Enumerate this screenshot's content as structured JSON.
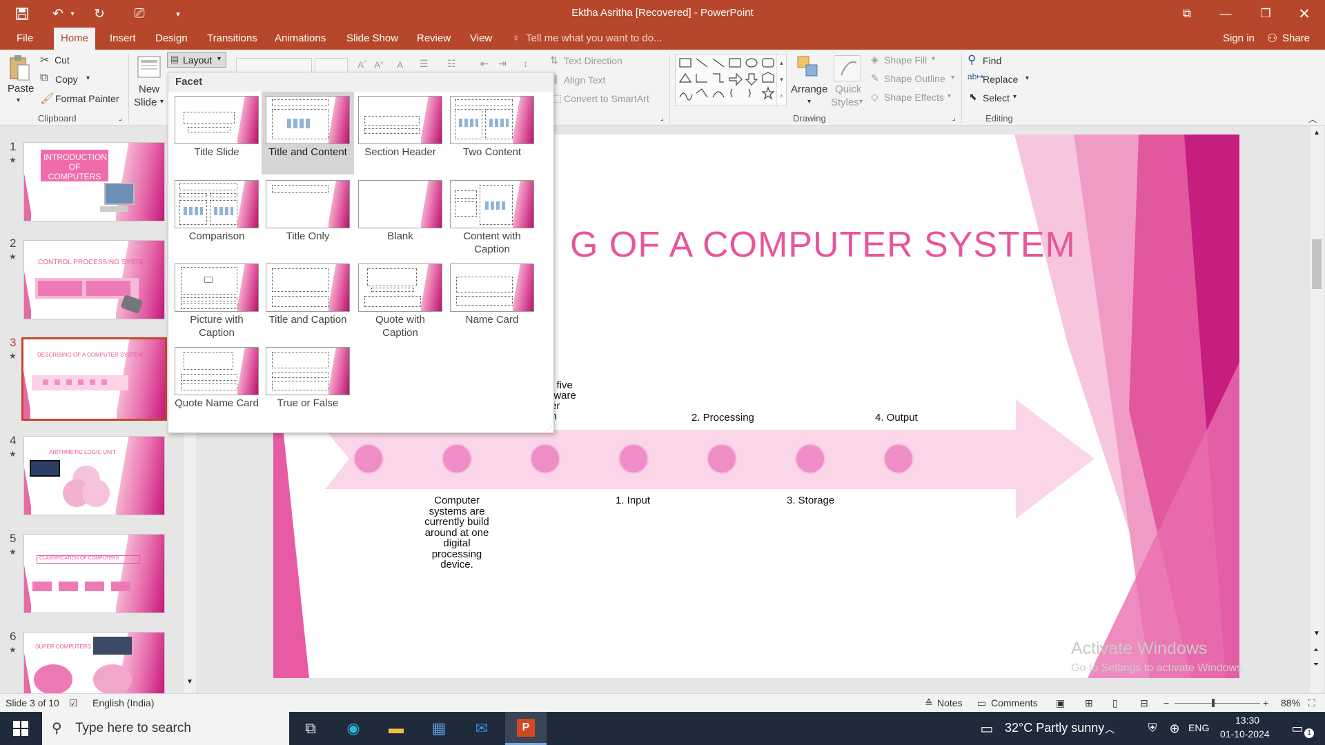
{
  "window": {
    "title": "Ektha Asritha [Recovered] - PowerPoint",
    "quick_access": [
      "save-icon",
      "undo-icon",
      "redo-icon",
      "present-icon",
      "customize-icon"
    ]
  },
  "menu": {
    "tabs": [
      "File",
      "Home",
      "Insert",
      "Design",
      "Transitions",
      "Animations",
      "Slide Show",
      "Review",
      "View"
    ],
    "active_tab": "Home",
    "tell_me": "Tell me what you want to do...",
    "sign_in": "Sign in",
    "share": "Share"
  },
  "ribbon": {
    "clipboard": {
      "paste": "Paste",
      "cut": "Cut",
      "copy": "Copy",
      "format_painter": "Format Painter",
      "group_label": "Clipboard"
    },
    "slides": {
      "new_slide": "New",
      "new_slide_2": "Slide",
      "layout": "Layout"
    },
    "paragraph": {
      "text_direction": "Text Direction",
      "align_text": "Align Text",
      "convert_smartart": "Convert to SmartArt"
    },
    "drawing": {
      "arrange": "Arrange",
      "quick_styles": "Quick",
      "quick_styles_2": "Styles",
      "shape_fill": "Shape Fill",
      "shape_outline": "Shape Outline",
      "shape_effects": "Shape Effects",
      "group_label": "Drawing"
    },
    "editing": {
      "find": "Find",
      "replace": "Replace",
      "select": "Select",
      "group_label": "Editing"
    }
  },
  "layout_menu": {
    "header": "Facet",
    "items": [
      {
        "name": "Title Slide"
      },
      {
        "name": "Title and Content"
      },
      {
        "name": "Section Header"
      },
      {
        "name": "Two Content"
      },
      {
        "name": "Comparison"
      },
      {
        "name": "Title Only"
      },
      {
        "name": "Blank"
      },
      {
        "name": "Content with Caption"
      },
      {
        "name": "Picture with Caption"
      },
      {
        "name": "Title and Caption"
      },
      {
        "name": "Quote with Caption"
      },
      {
        "name": "Name Card"
      },
      {
        "name": "Quote Name Card"
      },
      {
        "name": "True or False"
      }
    ],
    "selected": "Title and Content"
  },
  "thumbnails": [
    {
      "num": "1",
      "title": "INTRODUCTION OF COMPUTERS"
    },
    {
      "num": "2",
      "title": "CONTROL PROCESSING SYSTE"
    },
    {
      "num": "3",
      "title": "DESCRIBING OF A COMPUTER SYSTEM"
    },
    {
      "num": "4",
      "title": "ARITHMETIC LOGIC UNIT"
    },
    {
      "num": "5",
      "title": "CLASSIFICATION OF COMPUTERS"
    },
    {
      "num": "6",
      "title": "SUPER COMPUTERS"
    }
  ],
  "slide": {
    "title": "G OF A COMPUTER SYSTEM",
    "intro_fragment": [
      "e five",
      "dware",
      "ter",
      "m"
    ],
    "labels_top": [
      "2. Processing",
      "4. Output"
    ],
    "labels_bottom": [
      "1. Input",
      "3. Storage"
    ],
    "body_text": [
      "Computer",
      "systems are",
      "currently build",
      "around at one",
      "digital",
      "processing",
      "device."
    ]
  },
  "watermark": {
    "line1": "Activate Windows",
    "line2": "Go to Settings to activate Windows."
  },
  "statusbar": {
    "slide_info": "Slide 3 of 10",
    "language": "English (India)",
    "notes": "Notes",
    "comments": "Comments",
    "zoom": "88%"
  },
  "taskbar": {
    "search": "Type here to search",
    "weather": "32°C  Partly sunny",
    "lang": "ENG",
    "time": "13:30",
    "date": "01-10-2024",
    "notifications": "1"
  },
  "colors": {
    "accent": "#b7472a",
    "pink": "#e8559a",
    "taskbar": "#1f2a3a"
  }
}
